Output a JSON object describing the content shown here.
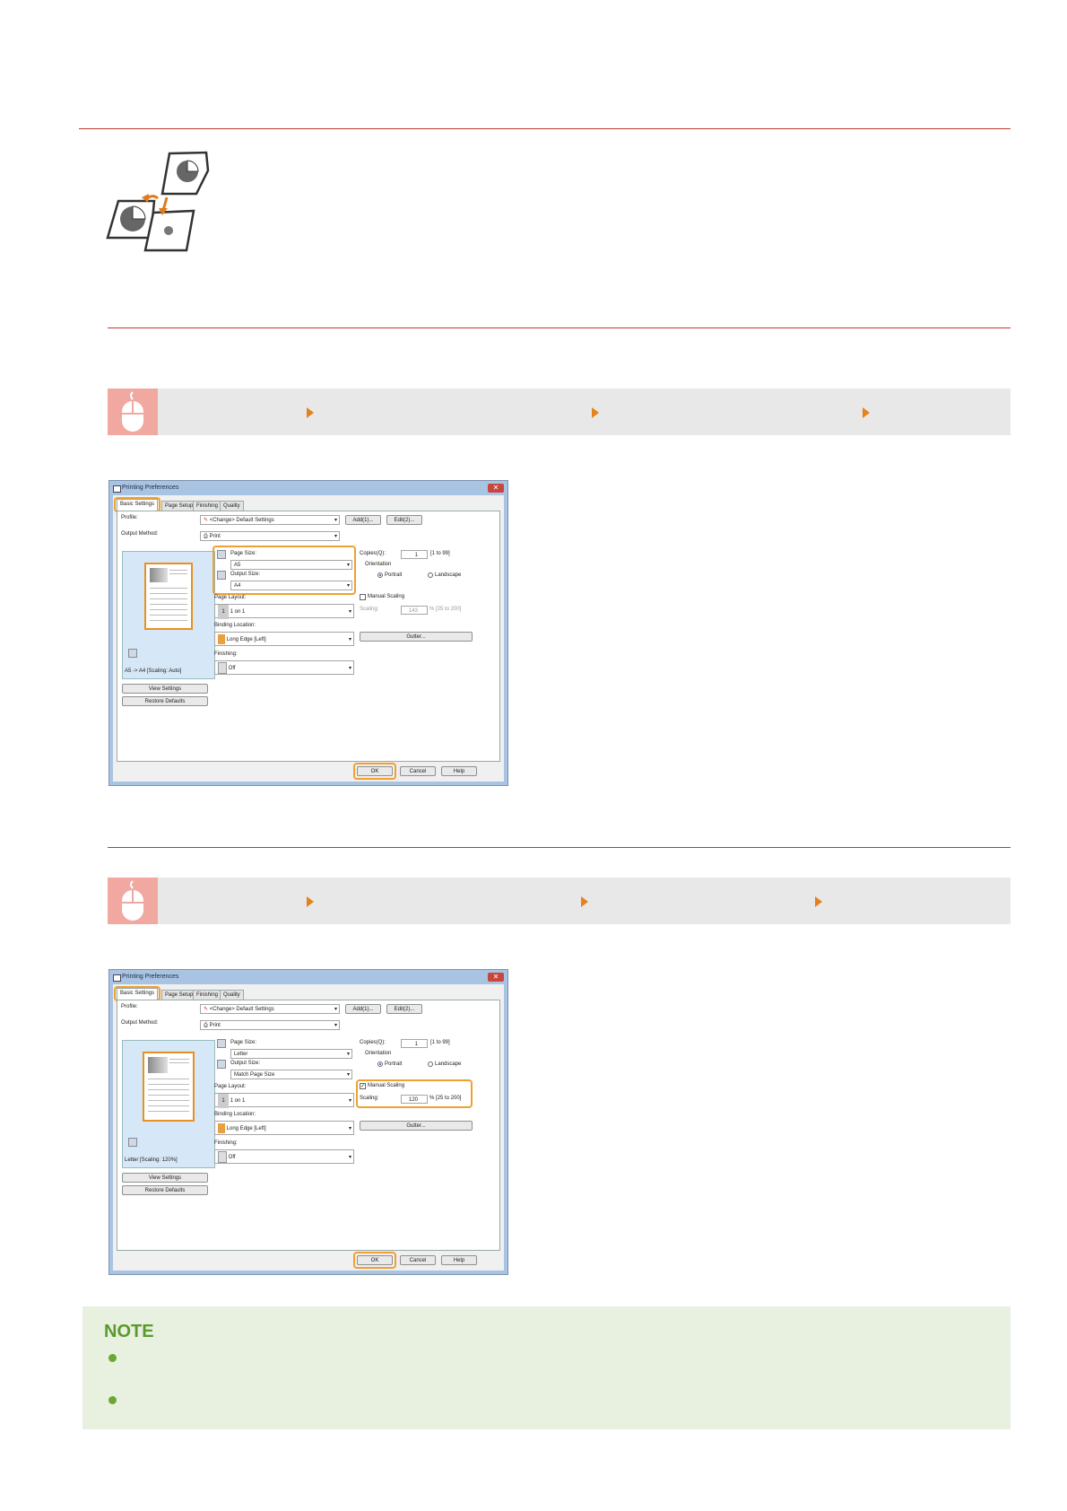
{
  "illustration": {
    "icon": "page-scaling-icon"
  },
  "nav_bars": [
    {
      "icon": "mouse-icon",
      "arrows": 3
    },
    {
      "icon": "mouse-icon",
      "arrows": 3
    }
  ],
  "dialogs": [
    {
      "title": "Printing Preferences",
      "close": "✕",
      "tabs": [
        "Basic Settings",
        "Page Setup",
        "Finishing",
        "Quality"
      ],
      "profile_label": "Profile:",
      "profile_value": "<Change> Default Settings",
      "add_button": "Add(1)...",
      "edit_button": "Edit(2)...",
      "output_method_label": "Output Method:",
      "output_method_value": "Print",
      "page_size_label": "Page Size:",
      "page_size_value": "A5",
      "output_size_label": "Output Size:",
      "output_size_value": "A4",
      "page_layout_label": "Page Layout:",
      "page_layout_value": "1 on 1",
      "page_layout_number": "1",
      "binding_label": "Binding Location:",
      "binding_value": "Long Edge [Left]",
      "finishing_label": "Finishing:",
      "finishing_value": "Off",
      "copies_label": "Copies(Q):",
      "copies_value": "1",
      "copies_range": "[1 to 99]",
      "orientation_label": "Orientation",
      "portrait_label": "Portrait",
      "landscape_label": "Landscape",
      "manual_scaling_label": "Manual Scaling",
      "manual_scaling_checked": false,
      "scaling_label": "Scaling:",
      "scaling_value": "143",
      "scaling_range": "% [25 to 200]",
      "gutter_button": "Gutter...",
      "preview_caption": "A5 -> A4 [Scaling: Auto]",
      "view_settings_button": "View Settings",
      "restore_defaults_button": "Restore Defaults",
      "ok_button": "OK",
      "cancel_button": "Cancel",
      "help_button": "Help"
    },
    {
      "title": "Printing Preferences",
      "close": "✕",
      "tabs": [
        "Basic Settings",
        "Page Setup",
        "Finishing",
        "Quality"
      ],
      "profile_label": "Profile:",
      "profile_value": "<Change> Default Settings",
      "add_button": "Add(1)...",
      "edit_button": "Edit(2)...",
      "output_method_label": "Output Method:",
      "output_method_value": "Print",
      "page_size_label": "Page Size:",
      "page_size_value": "Letter",
      "output_size_label": "Output Size:",
      "output_size_value": "Match Page Size",
      "page_layout_label": "Page Layout:",
      "page_layout_value": "1 on 1",
      "page_layout_number": "1",
      "binding_label": "Binding Location:",
      "binding_value": "Long Edge [Left]",
      "finishing_label": "Finishing:",
      "finishing_value": "Off",
      "copies_label": "Copies(Q):",
      "copies_value": "1",
      "copies_range": "[1 to 99]",
      "orientation_label": "Orientation",
      "portrait_label": "Portrait",
      "landscape_label": "Landscape",
      "manual_scaling_label": "Manual Scaling",
      "manual_scaling_checked": true,
      "scaling_label": "Scaling:",
      "scaling_value": "120",
      "scaling_range": "% [25 to 200]",
      "gutter_button": "Gutter...",
      "preview_caption": "Letter [Scaling: 120%]",
      "view_settings_button": "View Settings",
      "restore_defaults_button": "Restore Defaults",
      "ok_button": "OK",
      "cancel_button": "Cancel",
      "help_button": "Help"
    }
  ],
  "note": {
    "title": "NOTE",
    "bullets": 2
  }
}
